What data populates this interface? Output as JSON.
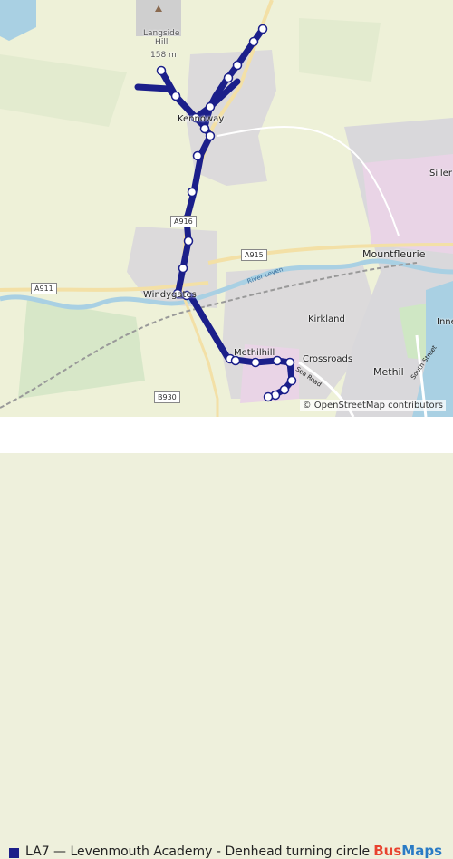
{
  "map": {
    "places": {
      "langside_hill": "Langside\nHill",
      "langside_elev": "158 m",
      "kennoway": "Kennoway",
      "windygates": "Windygates",
      "kirkland": "Kirkland",
      "methilhill": "Methilhill",
      "crossroads": "Crossroads",
      "methil": "Methil",
      "mountfleurie": "Mountfleurie",
      "innerleven": "Innerl",
      "silverburn": "Siller"
    },
    "roads": {
      "a911": "A911",
      "a916": "A916",
      "a915": "A915",
      "b930": "B930",
      "sea_road": "Sea Road",
      "south_street": "South Street",
      "river_leven": "River Leven"
    },
    "route_color": "#1b1f8a",
    "attribution": "© OpenStreetMap contributors"
  },
  "legend": {
    "route_label": "LA7 — Levenmouth Academy - Denhead turning circle"
  },
  "brand": {
    "part1": "Bus",
    "part2": "Maps"
  }
}
